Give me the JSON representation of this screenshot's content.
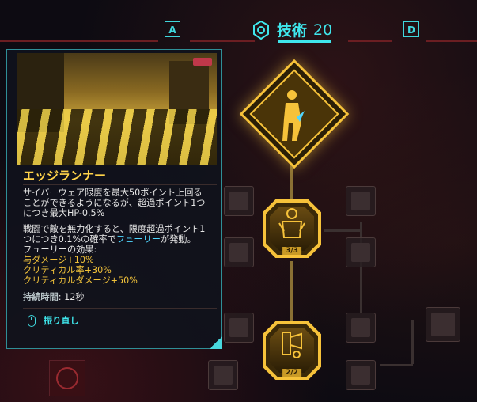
{
  "header": {
    "key_left": "A",
    "key_right": "D",
    "skill_icon": "technical-ability-icon",
    "skill_name": "技術",
    "skill_level": "20"
  },
  "card": {
    "title": "エッジランナー",
    "desc1_lines": [
      "サイバーウェア限度を最大50ポイント上回る",
      "ことができるようになるが、超過ポイント1つ",
      "につき最大HP-0.5%"
    ],
    "desc2_a": "戦闘で敵を無力化すると、限度超過ポイント1",
    "desc2_b_pre": "つにつき0.1%の確率で",
    "desc2_b_hl": "フューリー",
    "desc2_b_post": "が発動。",
    "desc2_c": "フューリーの効果:",
    "effects": [
      "与ダメージ+10%",
      "クリティカル率+30%",
      "クリティカルダメージ+50%"
    ],
    "duration_label": "持続時間",
    "duration_value": ": 12秒",
    "reset_label": "振り直し"
  },
  "nodes": {
    "node2_badge": "3/3",
    "node3_badge": "2/2"
  },
  "colors": {
    "accent": "#3fe6ec",
    "gold": "#f6c23a",
    "highlight": "#4fd6ff"
  }
}
